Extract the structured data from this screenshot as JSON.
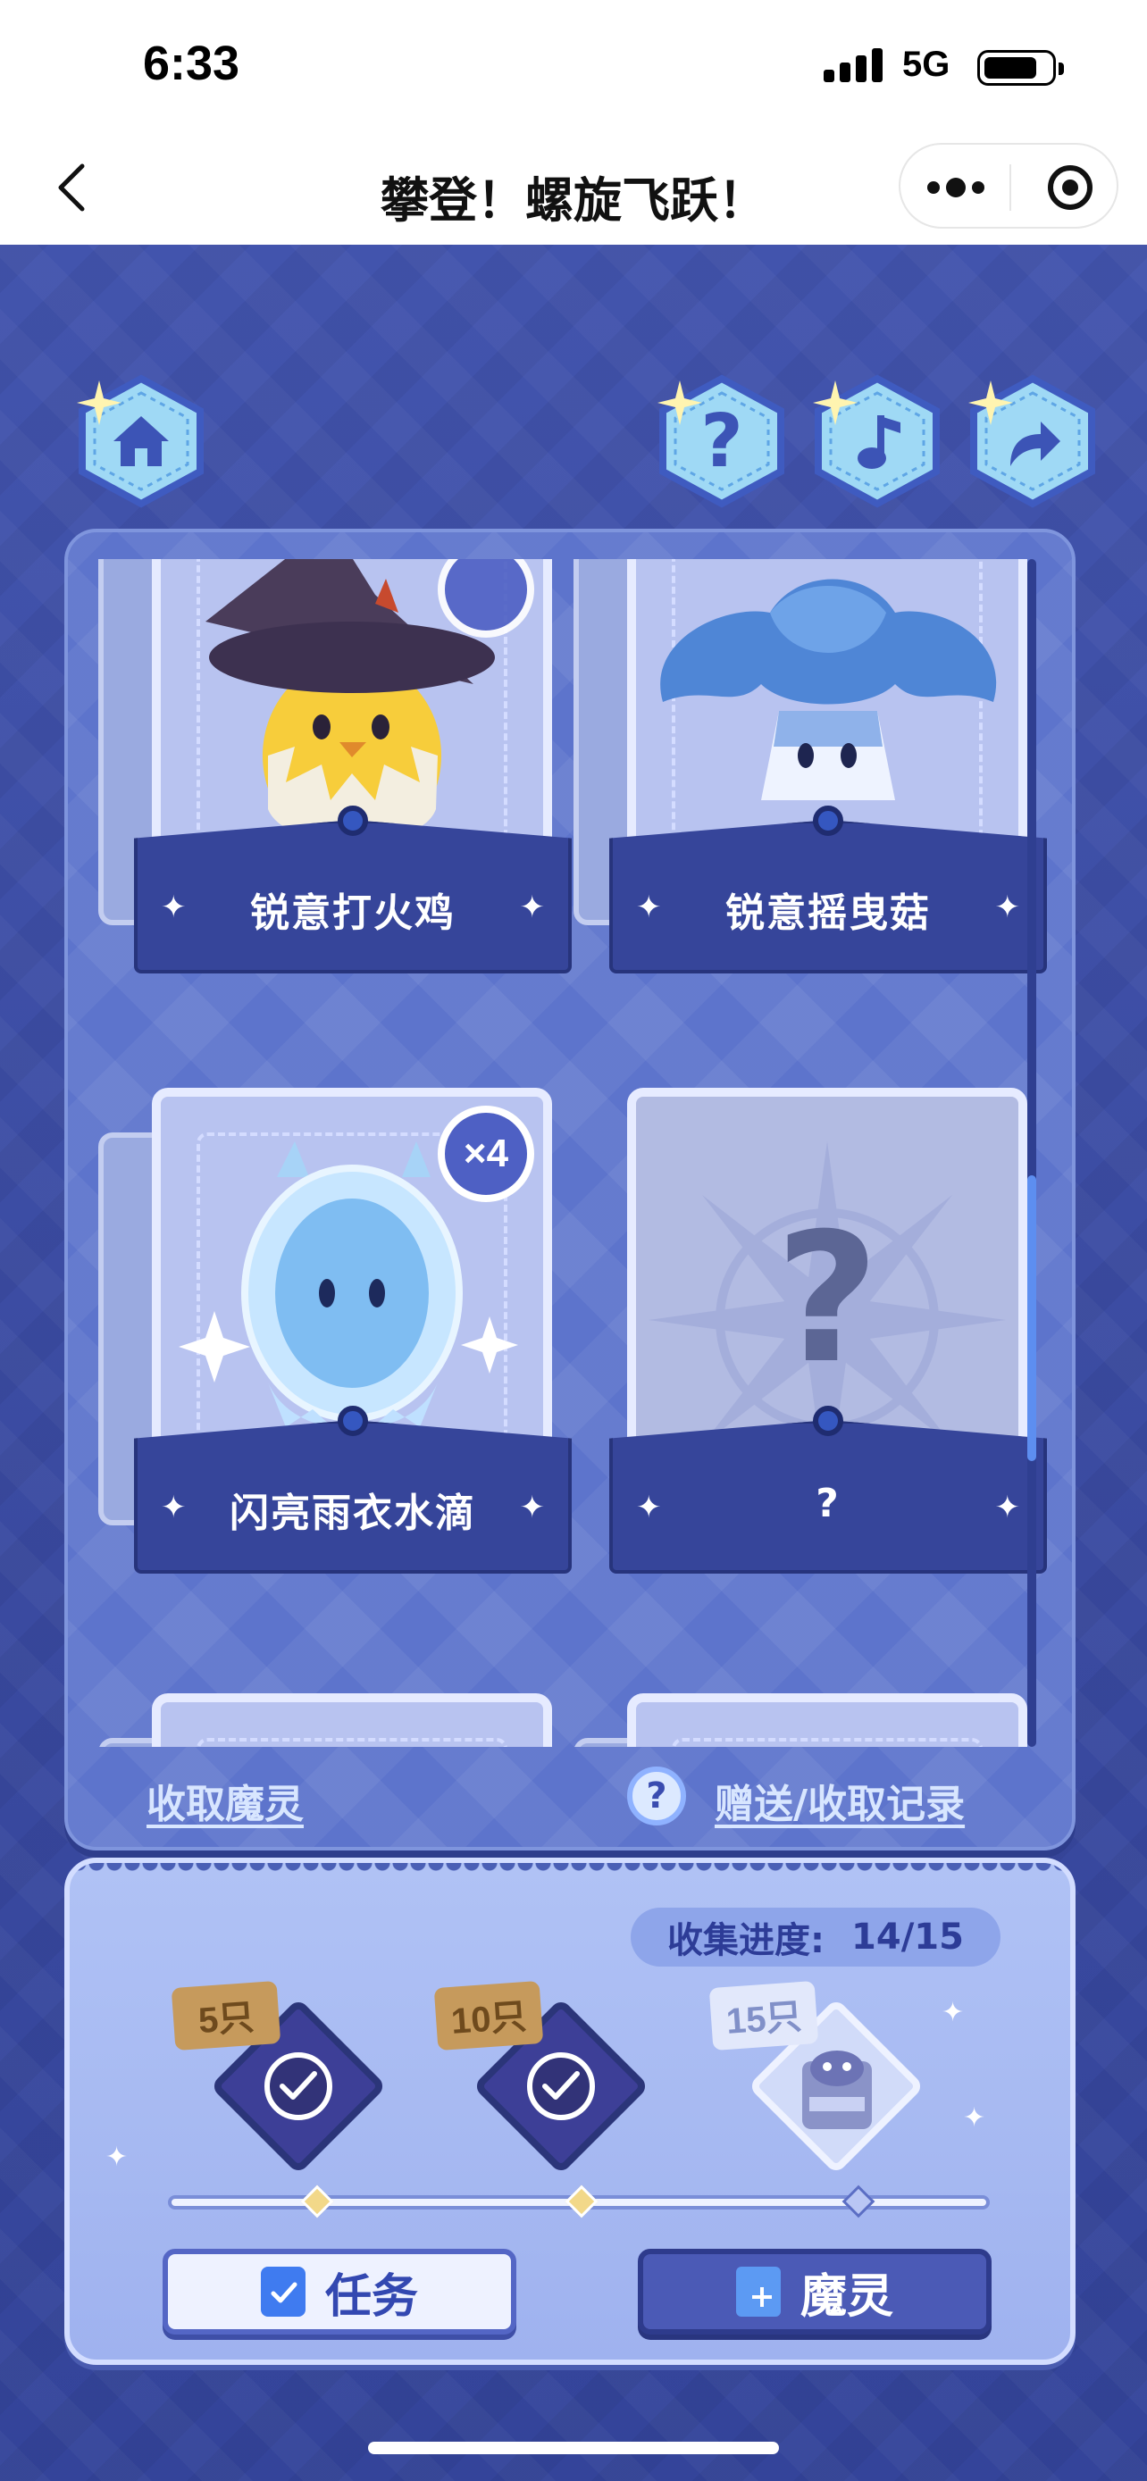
{
  "status_bar": {
    "time": "6:33",
    "network": "5G",
    "battery_level": 0.8
  },
  "nav": {
    "title": "攀登！螺旋飞跃！",
    "back_icon": "chevron-left-icon",
    "more_icon": "more-dots-icon",
    "close_icon": "mini-program-close-icon"
  },
  "top_buttons": {
    "home": {
      "icon": "home-icon"
    },
    "help": {
      "icon": "question-icon"
    },
    "music": {
      "icon": "music-note-icon"
    },
    "share": {
      "icon": "share-arrow-icon"
    }
  },
  "cards": [
    {
      "name": "锐意打火鸡",
      "badge": "",
      "art": "chick-witch-hat",
      "known": true
    },
    {
      "name": "锐意摇曳菇",
      "badge": "",
      "art": "blue-mushroom",
      "known": true
    },
    {
      "name": "闪亮雨衣水滴",
      "badge": "×4",
      "art": "water-drop",
      "known": true
    },
    {
      "name": "?",
      "badge": "",
      "art": "unknown",
      "known": false
    }
  ],
  "panel_footer": {
    "receive_label": "收取魔灵",
    "record_label": "赠送/收取记录"
  },
  "progress": {
    "label": "收集进度:",
    "value": "14/15",
    "milestones": [
      {
        "tag": "5只",
        "achieved": true
      },
      {
        "tag": "10只",
        "achieved": true
      },
      {
        "tag": "15只",
        "achieved": false
      }
    ]
  },
  "buttons": {
    "task_label": "任务",
    "spirit_label": "魔灵"
  },
  "colors": {
    "accent": "#3d4fa6",
    "panel": "#5d74cc",
    "link": "#d8e6ff"
  }
}
